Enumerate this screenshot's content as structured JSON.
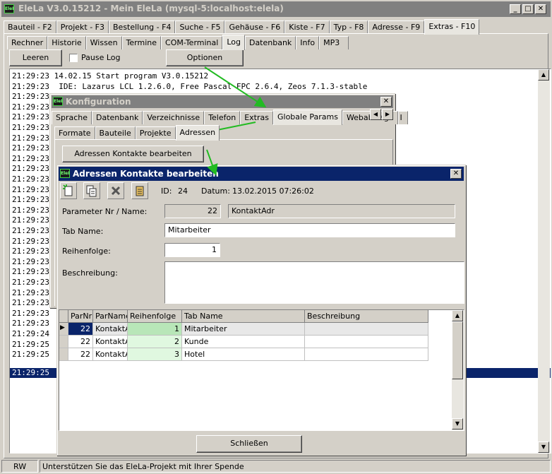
{
  "main_window": {
    "title": "EleLa V3.0.15212  - Mein EleLa (mysql-5:localhost:elela)",
    "icon_text": "EleLa"
  },
  "main_tabs": [
    "Bauteil - F2",
    "Projekt - F3",
    "Bestellung - F4",
    "Suche - F5",
    "Gehäuse - F6",
    "Kiste - F7",
    "Typ - F8",
    "Adresse - F9",
    "Extras - F10"
  ],
  "sub_tabs": [
    "Rechner",
    "Historie",
    "Wissen",
    "Termine",
    "COM-Terminal",
    "Log",
    "Datenbank",
    "Info",
    "MP3"
  ],
  "log_toolbar": {
    "leeren": "Leeren",
    "pause": "Pause Log",
    "optionen": "Optionen"
  },
  "log_lines": [
    "21:29:23 14.02.15 Start program V3.0.15212",
    "21:29:23  IDE: Lazarus LCL 1.2.6.0, Free Pascal FPC 2.6.4, Zeos 7.1.3-stable",
    "21:29:23",
    "21:29:23",
    "21:29:23",
    "21:29:23",
    "21:29:23",
    "21:29:23",
    "21:29:23",
    "21:29:23",
    "21:29:23",
    "21:29:23",
    "21:29:23",
    "21:29:23",
    "21:29:23",
    "21:29:23",
    "21:29:23",
    "21:29:23",
    "21:29:23",
    "21:29:23",
    "21:29:23",
    "21:29:23",
    "21:29:23",
    "21:29:23",
    "21:29:23",
    "21:29:24",
    "21:29:25",
    "21:29:25",
    "21:29:25"
  ],
  "konfig": {
    "title": "Konfiguration",
    "tabs": [
      "Sprache",
      "Datenbank",
      "Verzeichnisse",
      "Telefon",
      "Extras",
      "Globale Params",
      "Webabfrage",
      "I"
    ],
    "subtabs": [
      "Formate",
      "Bauteile",
      "Projekte",
      "Adressen"
    ],
    "button": "Adressen Kontakte bearbeiten"
  },
  "dialog": {
    "title": "Adressen Kontakte bearbeiten",
    "id_label": "ID:",
    "id_value": "24",
    "datum_label": "Datum:",
    "datum_value": "13.02.2015 07:26:02",
    "param_label": "Parameter Nr / Name:",
    "param_nr": "22",
    "param_name": "KontaktAdr",
    "tabname_label": "Tab Name:",
    "tabname_value": "Mitarbeiter",
    "reihenfolge_label": "Reihenfolge:",
    "reihenfolge_value": "1",
    "beschreibung_label": "Beschreibung:",
    "beschreibung_value": "",
    "grid_headers": [
      "ParNr",
      "ParName",
      "Reihenfolge",
      "Tab Name",
      "Beschreibung"
    ],
    "grid_rows": [
      [
        "22",
        "KontaktA",
        "1",
        "Mitarbeiter",
        ""
      ],
      [
        "22",
        "KontaktA",
        "2",
        "Kunde",
        ""
      ],
      [
        "22",
        "KontaktA",
        "3",
        "Hotel",
        ""
      ]
    ],
    "close_button": "Schließen"
  },
  "status": {
    "mode": "RW",
    "message": "Unterstützen Sie das EleLa-Projekt mit Ihrer Spende"
  },
  "colors": {
    "arrow": "#22bb22",
    "selection": "#0a246a",
    "row_highlight": "#ccffcc"
  }
}
